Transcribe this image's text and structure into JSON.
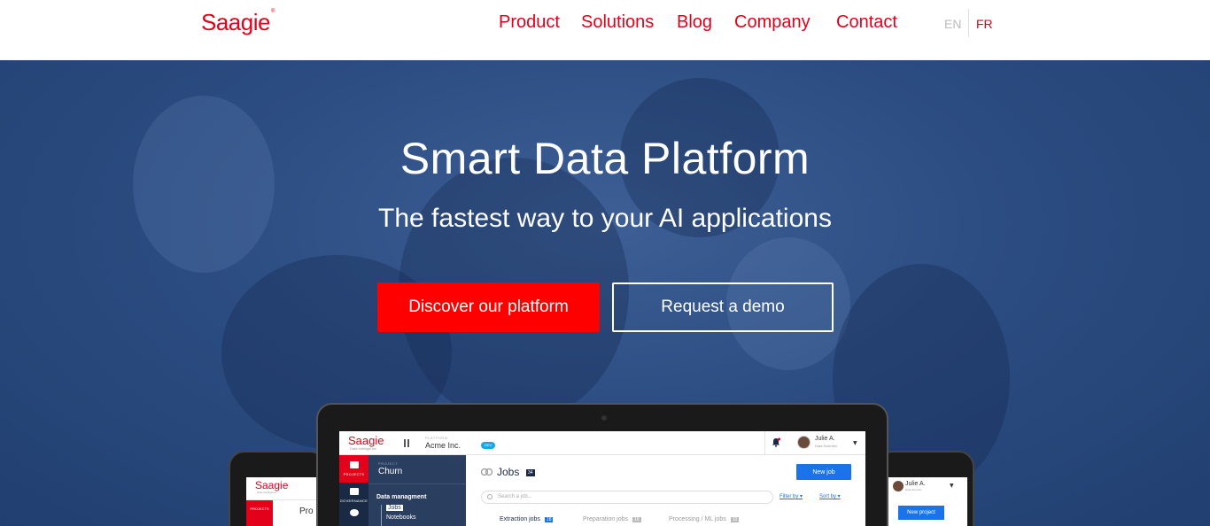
{
  "brand": {
    "logo": "Saagie",
    "color": "#e2001a"
  },
  "nav": [
    {
      "label": "Product"
    },
    {
      "label": "Solutions"
    },
    {
      "label": "Blog"
    },
    {
      "label": "Company"
    },
    {
      "label": "Contact"
    }
  ],
  "languages": {
    "en": "EN",
    "fr": "FR"
  },
  "hero": {
    "title": "Smart Data Platform",
    "subtitle": "The fastest way to your AI applications",
    "primary_button": "Discover our platform",
    "secondary_button": "Request a demo",
    "primary_color": "#ff0000",
    "bg_color": "#2c4d82"
  },
  "app_screen": {
    "logo": "Saagie",
    "logo_sub": "Data Intelligence",
    "platform_label": "PLATFORM",
    "platform_value": "Acme Inc.",
    "env_badge": "DEV",
    "user_name": "Julie A.",
    "user_role": "Data Scientist",
    "sidebar": {
      "projects": "PROJECTS",
      "governance": "GOVERNANCE"
    },
    "project_label": "PROJECT",
    "project_value": "Churn",
    "section": "Data managment",
    "items": [
      "Jobs",
      "Notebooks"
    ],
    "jobs_title": "Jobs",
    "jobs_count": "34",
    "new_job": "New job",
    "search_placeholder": "Search a job...",
    "filter_by": "Filter by ▾",
    "sort_by": "Sort by ▾",
    "tabs": [
      {
        "label": "Extraction jobs",
        "count": "18"
      },
      {
        "label": "Preparation jobs",
        "count": "16"
      },
      {
        "label": "Processing / ML jobs",
        "count": "10"
      }
    ]
  },
  "left_screen": {
    "logo": "Saagie",
    "logo_sub": "Data Intelligence",
    "sidebar": "PROJECTS",
    "text": "Pro"
  },
  "right_screen": {
    "user_name": "Julie A.",
    "user_role": "Data Scientist",
    "button": "New project"
  }
}
